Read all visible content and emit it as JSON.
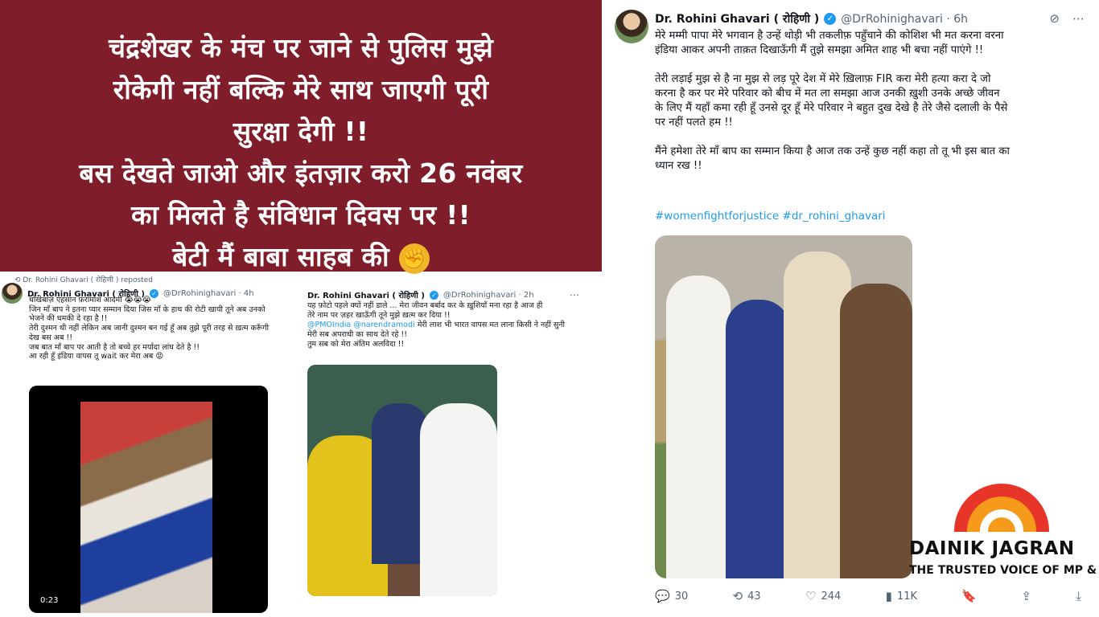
{
  "banner": {
    "lines": [
      "चंद्रशेखर के मंच पर जाने से पुलिस मुझे",
      "रोकेगी नहीं बल्कि मेरे साथ जाएगी पूरी",
      "सुरक्षा देगी !!",
      "बस देखते जाओ और इंतज़ार करो 26 नवंबर",
      "का मिलते है संविधान दिवस पर !!",
      "बेटी मैं बाबा साहब की"
    ],
    "emoji": "✊"
  },
  "tweet_left": {
    "repost_label": "Dr. Rohini Ghavari ( रोहिणी ) reposted",
    "name": "Dr. Rohini Ghavari ( रोहिणी )",
    "verified_glyph": "✓",
    "handle": "@DrRohinighavari · 4h",
    "lines": [
      "धोखेबाज़ एहसान फ़रामोश आदमी 😭😭😭",
      "जिन माँ बाप ने इतना प्यार सम्मान दिया जिस माँ के हाथ की रोटी खायी तूने अब उनको",
      "भेजने की धमकी दे रहा है !!",
      "तेरी दुश्मन थी नहीं लेकिन अब जानी दुश्मन बन गई हूँ अब तुझे पूरी तरह से ख़त्म करूँगी",
      "देख बस अब !!",
      "जब बात माँ बाप पर आती है तो बच्चे हर मर्यादा लांघ देते है !!",
      "आ रही हूँ इंडिया वापस तू wait कर मेरा अब 😡"
    ],
    "video_time": "0:23"
  },
  "tweet_mid": {
    "name": "Dr. Rohini Ghavari ( रोहिणी )",
    "verified_glyph": "✓",
    "handle": "@DrRohinighavari · 2h",
    "more": "⋯",
    "lines": [
      "यह फ़ोटो पहले क्यों नहीं डाले ... मेरा जीवन बर्बाद कर के ख़ुशियाँ मना रहा है आज ही",
      "तेरे नाम पर ज़हर खाऊँगी तूने मुझे ख़त्म कर दिया !!"
    ],
    "mention1": "@PMOIndia",
    "mention2": "@narendramodi",
    "mention_line": "मेरी लाश भी भारत वापस मत लाना किसी ने नहीं सुनी",
    "lines2": [
      "मेरी सब अपराधी का साथ देते रहे !!",
      "तुम सब को मेरा अंतिम अलविदा !!"
    ]
  },
  "tweet_right": {
    "name": "Dr. Rohini Ghavari ( रोहिणी )",
    "verified_glyph": "✓",
    "handle": "@DrRohinighavari · 6h",
    "top_icons": [
      "⊘",
      "⋯"
    ],
    "paragraph1": [
      "मेरे मम्मी पापा मेरे भगवान है उन्हें थोड़ी भी तकलीफ़ पहुँचाने की कोशिश भी मत करना वरना",
      "इंडिया आकर अपनी ताक़त दिखाऊँगी मैं तुझे समझा अमित शाह भी बचा नहीं पाएंगे !!"
    ],
    "paragraph2": [
      "तेरी लड़ाई मुझ से है ना मुझ से लड़ पूरे देश में मेरे ख़िलाफ़ FIR करा मेरी हत्या करा दे जो",
      "करना है कर पर मेरे परिवार को बीच में मत ला समझा आज उनकी ख़ुशी उनके अच्छे जीवन",
      "के लिए मैं यहाँ कमा रही हूँ उनसे दूर हूँ मेरे परिवार ने बहुत दुख देखे है तेरे जैसे दलाली के पैसे",
      "पर नहीं पलते हम !!"
    ],
    "paragraph3": [
      "मैंने हमेशा तेरे माँ बाप का सम्मान किया है आज तक उन्हें कुछ नहीं कहा तो तू भी इस बात का",
      "ध्यान रख !!"
    ],
    "hashtags": [
      "#womenfightforjustice",
      "#dr_rohini_ghavari"
    ],
    "actions": [
      {
        "icon": "💬",
        "label": "30"
      },
      {
        "icon": "⟲",
        "label": "43"
      },
      {
        "icon": "♡",
        "label": "244"
      },
      {
        "icon": "▮",
        "label": "11K"
      },
      {
        "icon": "🔖",
        "label": ""
      },
      {
        "icon": "⇪",
        "label": ""
      },
      {
        "icon": "⤓",
        "label": ""
      }
    ]
  },
  "logo": {
    "name": "DAINIK JAGRAN",
    "tagline": "THE TRUSTED VOICE OF MP & CG"
  }
}
